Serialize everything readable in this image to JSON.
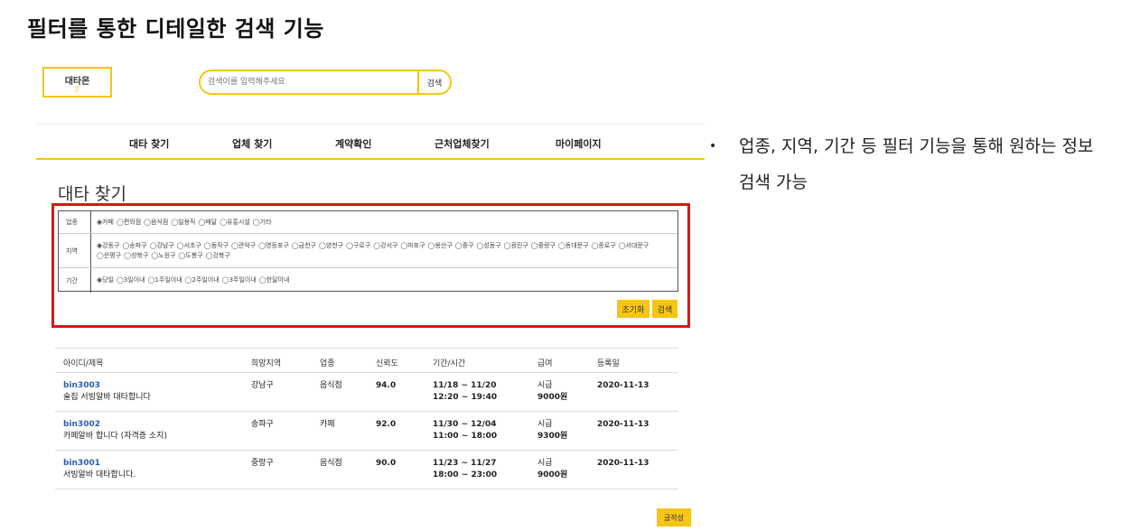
{
  "slide": {
    "title": "필터를 통한 디테일한 검색 기능",
    "bullet": "업종, 지역, 기간 등 필터 기능을 통해 원하는 정보 검색 가능"
  },
  "header": {
    "logo_text": "대타몬",
    "search_placeholder": "검색어를 입력해주세요",
    "search_button": "검색"
  },
  "nav": {
    "items": [
      {
        "label": "대타 찾기"
      },
      {
        "label": "업체 찾기"
      },
      {
        "label": "계약확인"
      },
      {
        "label": "근처업체찾기"
      },
      {
        "label": "마이페이지"
      }
    ]
  },
  "page_title": "대타 찾기",
  "filters": {
    "industry": {
      "label": "업종",
      "options": [
        "◉카페",
        "◯편의점",
        "◯음식점",
        "◯일용직",
        "◯배달",
        "◯유흥시설",
        "◯기타"
      ]
    },
    "region": {
      "label": "지역",
      "options": [
        "◉강동구",
        "◯송파구",
        "◯강남구",
        "◯서초구",
        "◯동작구",
        "◯관악구",
        "◯영등포구",
        "◯금천구",
        "◯양천구",
        "◯구로구",
        "◯강서구",
        "◯마포구",
        "◯용산구",
        "◯중구",
        "◯성동구",
        "◯광진구",
        "◯중랑구",
        "◯동대문구",
        "◯종로구",
        "◯서대문구",
        "◯은평구",
        "◯성북구",
        "◯노원구",
        "◯도봉구",
        "◯강북구"
      ]
    },
    "period": {
      "label": "기간",
      "options": [
        "◉당일",
        "◯3일이내",
        "◯1주일이내",
        "◯2주일이내",
        "◯3주일이내",
        "◯한달이내"
      ]
    },
    "reset_button": "초기화",
    "search_button": "검색"
  },
  "list": {
    "headers": [
      "아이디/제목",
      "희망지역",
      "업종",
      "신뢰도",
      "기간/시간",
      "급여",
      "등록일"
    ],
    "rows": [
      {
        "id": "bin3003",
        "title": "술집 서빙알바 대타합니다",
        "region": "강남구",
        "industry": "음식점",
        "trust": "94.0",
        "period": "11/18 ~ 11/20",
        "time": "12:20 ~ 19:40",
        "pay_type": "시급",
        "pay": "9000원",
        "date": "2020-11-13"
      },
      {
        "id": "bin3002",
        "title": "카페알바 합니다 (자격증 소지)",
        "region": "송파구",
        "industry": "카페",
        "trust": "92.0",
        "period": "11/30 ~ 12/04",
        "time": "11:00 ~ 18:00",
        "pay_type": "시급",
        "pay": "9300원",
        "date": "2020-11-13"
      },
      {
        "id": "bin3001",
        "title": "서빙알바 대타합니다.",
        "region": "중랑구",
        "industry": "음식점",
        "trust": "90.0",
        "period": "11/23 ~ 11/27",
        "time": "18:00 ~ 23:00",
        "pay_type": "시급",
        "pay": "9000원",
        "date": "2020-11-13"
      }
    ]
  },
  "write_button": "글작성",
  "colors": {
    "accent": "#f5c518",
    "highlight": "#e01414",
    "link": "#2a5db0"
  }
}
